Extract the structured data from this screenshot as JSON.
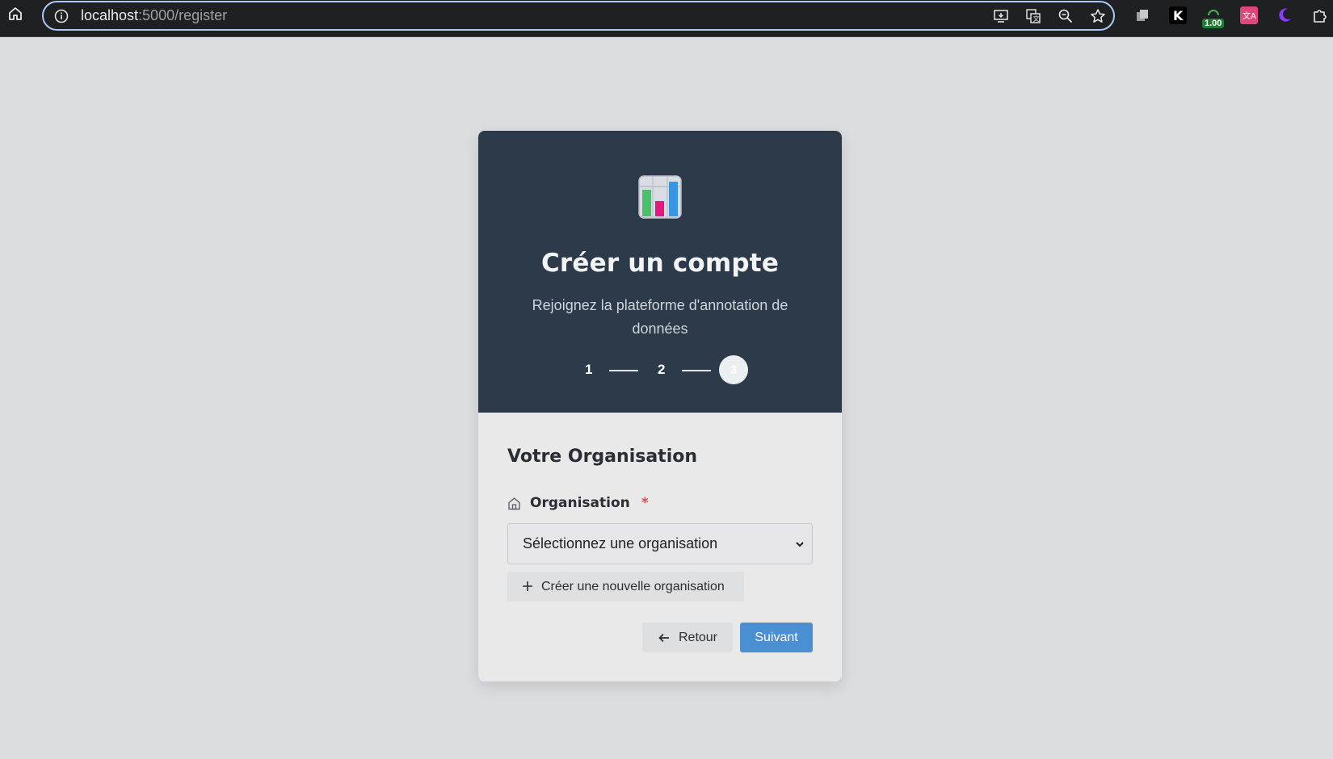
{
  "browser": {
    "url_host": "localhost",
    "url_path": ":5000/register",
    "extension_badge": "1.00"
  },
  "header": {
    "title": "Créer un compte",
    "subtitle": "Rejoignez la plateforme d'annotation de données",
    "steps": [
      "1",
      "2",
      "3"
    ],
    "current_step": "3"
  },
  "form": {
    "section_title": "Votre Organisation",
    "organisation_label": "Organisation",
    "required_marker": "*",
    "select_placeholder": "Sélectionnez une organisation",
    "create_org_label": "Créer une nouvelle organisation",
    "back_label": "Retour",
    "next_label": "Suivant"
  },
  "colors": {
    "header_bg": "#2c3a4a",
    "accent": "#4a8fd1",
    "required": "#d9534f"
  }
}
